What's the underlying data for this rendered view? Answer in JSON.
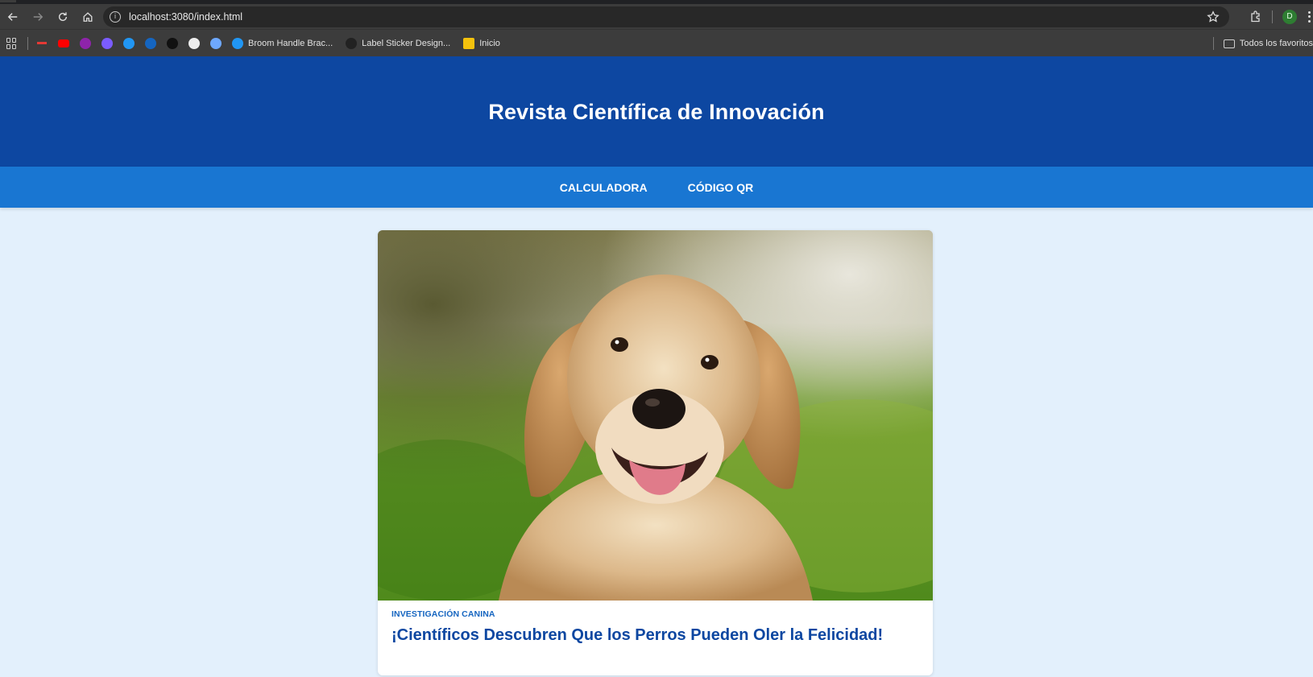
{
  "browser": {
    "url": "localhost:3080/index.html",
    "avatar_initial": "D",
    "bookmarks": [
      {
        "icon": "red-dash-icon",
        "label": "",
        "color": "#e53935"
      },
      {
        "icon": "youtube-icon",
        "label": "",
        "color": "#ff0000"
      },
      {
        "icon": "purple-u-icon",
        "label": "",
        "color": "#8e24aa"
      },
      {
        "icon": "messenger-icon",
        "label": "",
        "color": "#7b5cff"
      },
      {
        "icon": "blue-t-icon",
        "label": "",
        "color": "#2196f3"
      },
      {
        "icon": "outlook-icon",
        "label": "",
        "color": "#1565c0"
      },
      {
        "icon": "openai-icon",
        "label": "",
        "color": "#111111"
      },
      {
        "icon": "github-icon",
        "label": "",
        "color": "#eeeeee"
      },
      {
        "icon": "gem-icon",
        "label": "",
        "color": "#6ea8ff"
      }
    ],
    "labeled_bookmarks": [
      {
        "icon": "blue-t-icon",
        "label": "Broom Handle Brac...",
        "color": "#2196f3"
      },
      {
        "icon": "c-logo-icon",
        "label": "Label Sticker Design...",
        "color": "#222222"
      },
      {
        "icon": "image-icon",
        "label": "Inicio",
        "color": "#f4c20d"
      }
    ],
    "all_bookmarks_label": "Todos los favoritos"
  },
  "site": {
    "title": "Revista Científica de Innovación",
    "nav": [
      {
        "label": "Calculadora"
      },
      {
        "label": "Código QR"
      }
    ],
    "article": {
      "category": "Investigación Canina",
      "headline": "¡Científicos Descubren Que los Perros Pueden Oler la Felicidad!",
      "image": "golden-retriever-photo"
    }
  }
}
